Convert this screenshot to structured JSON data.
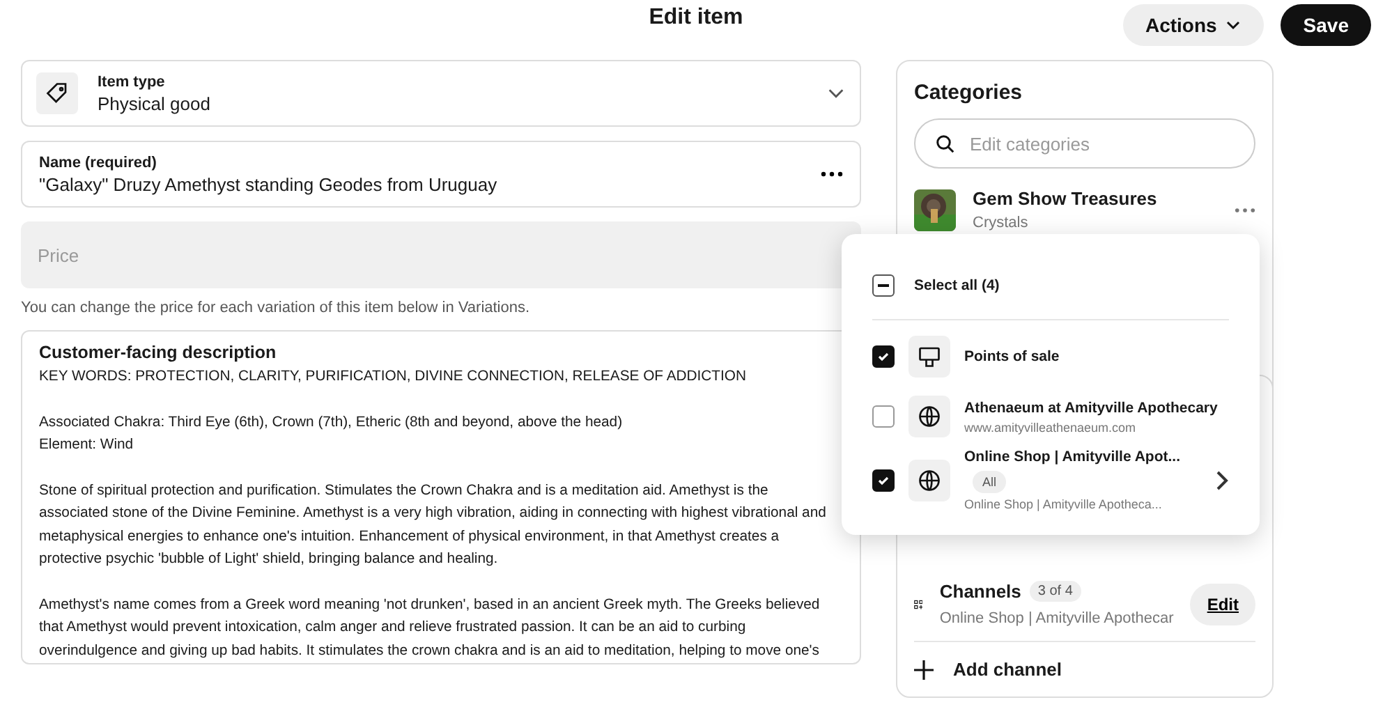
{
  "header": {
    "title": "Edit item",
    "actions_label": "Actions",
    "save_label": "Save"
  },
  "item_type": {
    "label": "Item type",
    "value": "Physical good"
  },
  "name_field": {
    "label": "Name (required)",
    "value": "\"Galaxy\" Druzy Amethyst standing Geodes from Uruguay"
  },
  "price_field": {
    "placeholder": "Price",
    "hint": "You can change the price for each variation of this item below in Variations."
  },
  "description": {
    "label": "Customer-facing description",
    "paragraphs": [
      "KEY WORDS: PROTECTION, CLARITY, PURIFICATION, DIVINE CONNECTION, RELEASE OF ADDICTION",
      "Associated Chakra: Third Eye (6th), Crown (7th), Etheric (8th and beyond, above the head)\nElement: Wind",
      "Stone of spiritual protection and purification. Stimulates the Crown Chakra and is a meditation aid. Amethyst is the associated stone of the Divine Feminine. Amethyst is a very high vibration, aiding in connecting with highest vibrational and metaphysical energies to enhance one's intuition. Enhancement of physical environment, in that Amethyst creates a protective psychic 'bubble of Light' shield, bringing balance and healing.",
      "Amethyst's name comes from a Greek word meaning 'not drunken', based in an ancient Greek myth. The Greeks believed that Amethyst would prevent intoxication, calm anger and relieve frustrated passion. It can be an aid to curbing overindulgence and giving up bad habits. It stimulates the crown chakra and is an aid to meditation, helping to move one's"
    ]
  },
  "categories": {
    "title": "Categories",
    "search_placeholder": "Edit categories",
    "items": [
      {
        "name": "Gem Show Treasures",
        "sub": "Crystals"
      }
    ]
  },
  "channels": {
    "title": "Channels",
    "count": "3 of 4",
    "summary": "Online Shop | Amityville Apothecar",
    "edit_label": "Edit",
    "add_label": "Add channel"
  },
  "channel_menu": {
    "select_all": {
      "label": "Select all (4)",
      "indeterminate": true
    },
    "items": [
      {
        "kind": "pos",
        "title": "Points of sale",
        "checked": true
      },
      {
        "kind": "web",
        "title": "Athenaeum at Amityville Apothecary",
        "sub": "www.amityvilleathenaeum.com",
        "checked": false
      },
      {
        "kind": "web",
        "title": "Online Shop | Amityville Apot...",
        "tag": "All",
        "sub": "Online Shop | Amityville Apotheca...",
        "checked": true,
        "has_arrow": true
      }
    ]
  }
}
